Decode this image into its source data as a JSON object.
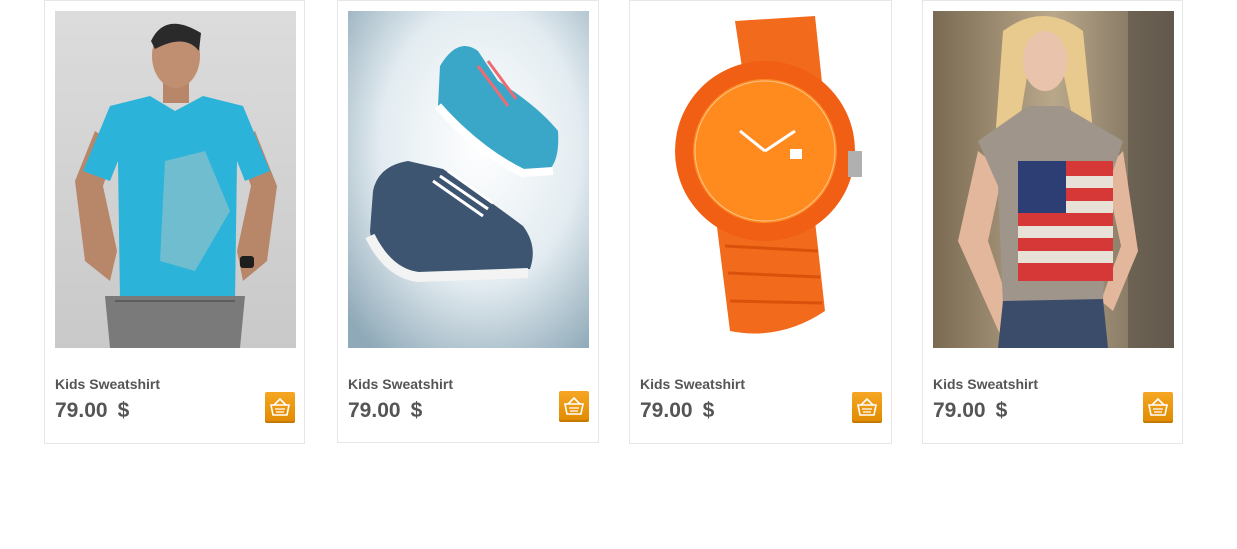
{
  "products": [
    {
      "name": "Kids Sweatshirt",
      "price": "79.00",
      "currency": "$",
      "image_icon": "man-blue-tshirt-photo",
      "cart_icon": "basket-icon"
    },
    {
      "name": "Kids Sweatshirt",
      "price": "79.00",
      "currency": "$",
      "image_icon": "sneakers-photo",
      "cart_icon": "basket-icon"
    },
    {
      "name": "Kids Sweatshirt",
      "price": "79.00",
      "currency": "$",
      "image_icon": "orange-watch-photo",
      "cart_icon": "basket-icon"
    },
    {
      "name": "Kids Sweatshirt",
      "price": "79.00",
      "currency": "$",
      "image_icon": "woman-flag-shirt-photo",
      "cart_icon": "basket-icon"
    }
  ],
  "colors": {
    "accent": "#f39c12",
    "text": "#555555",
    "border": "#e6e6e6"
  }
}
